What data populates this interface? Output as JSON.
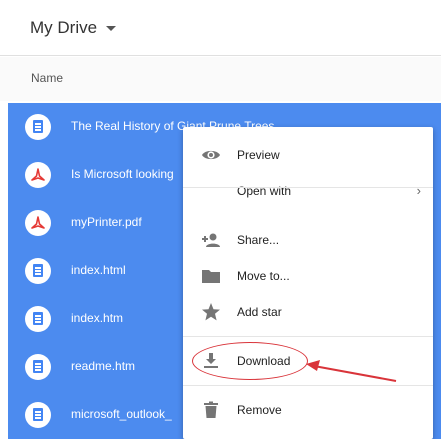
{
  "header": {
    "title": "My Drive"
  },
  "columns": {
    "name": "Name"
  },
  "files": [
    {
      "name": "The Real History of Giant Prune Trees",
      "type": "doc"
    },
    {
      "name": "Is Microsoft looking",
      "type": "pdf"
    },
    {
      "name": "myPrinter.pdf",
      "type": "pdf"
    },
    {
      "name": "index.html",
      "type": "doc"
    },
    {
      "name": "index.htm",
      "type": "doc"
    },
    {
      "name": "readme.htm",
      "type": "doc"
    },
    {
      "name": "microsoft_outlook_",
      "type": "doc"
    }
  ],
  "context_menu": {
    "items": [
      {
        "label": "Preview",
        "icon": "eye-icon"
      },
      {
        "label": "Open with",
        "icon": "",
        "submenu": true
      },
      {
        "label": "Share...",
        "icon": "add-person-icon"
      },
      {
        "label": "Move to...",
        "icon": "folder-icon"
      },
      {
        "label": "Add star",
        "icon": "star-icon"
      },
      {
        "label": "Download",
        "icon": "download-icon",
        "highlighted": true
      },
      {
        "label": "Remove",
        "icon": "trash-icon"
      }
    ]
  },
  "colors": {
    "selection": "#4c8bef",
    "annotation": "#d9343a",
    "doc_icon": "#4285f4",
    "pdf_icon": "#e53935"
  }
}
